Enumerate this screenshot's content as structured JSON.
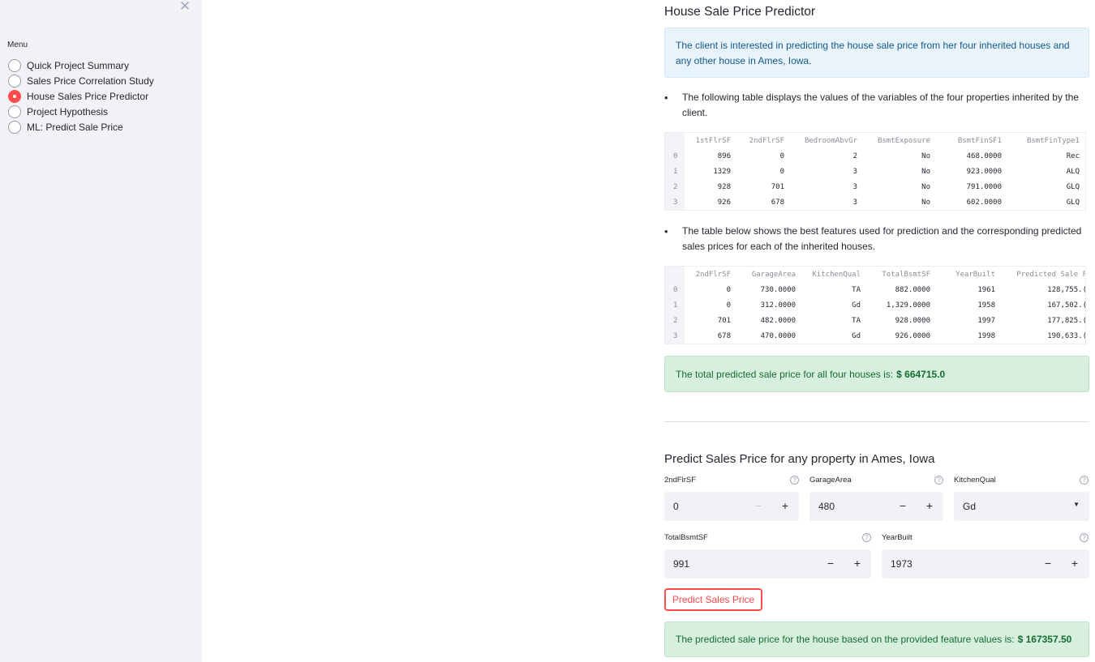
{
  "sidebar": {
    "close_icon": "close-icon",
    "menu_label": "Menu",
    "items": [
      {
        "label": "Quick Project Summary",
        "selected": false
      },
      {
        "label": "Sales Price Correlation Study",
        "selected": false
      },
      {
        "label": "House Sales Price Predictor",
        "selected": true
      },
      {
        "label": "Project Hypothesis",
        "selected": false
      },
      {
        "label": "ML: Predict Sale Price",
        "selected": false
      }
    ]
  },
  "main": {
    "title": "House Sale Price Predictor",
    "info": "The client is interested in predicting the house sale price from her four inherited houses and any other house in Ames, Iowa.",
    "bullet1": "The following table displays the values of the variables of the four properties inherited by the client.",
    "table1": {
      "columns": [
        "1stFlrSF",
        "2ndFlrSF",
        "BedroomAbvGr",
        "BsmtExposure",
        "BsmtFinSF1",
        "BsmtFinType1"
      ],
      "rows": [
        {
          "index": "0",
          "cells": [
            "896",
            "0",
            "2",
            "No",
            "468.0000",
            "Rec"
          ]
        },
        {
          "index": "1",
          "cells": [
            "1329",
            "0",
            "3",
            "No",
            "923.0000",
            "ALQ"
          ]
        },
        {
          "index": "2",
          "cells": [
            "928",
            "701",
            "3",
            "No",
            "791.0000",
            "GLQ"
          ]
        },
        {
          "index": "3",
          "cells": [
            "926",
            "678",
            "3",
            "No",
            "602.0000",
            "GLQ"
          ]
        }
      ]
    },
    "bullet2": "The table below shows the best features used for prediction and the corresponding predicted sales prices for each of the inherited houses.",
    "table2": {
      "columns": [
        "2ndFlrSF",
        "GarageArea",
        "KitchenQual",
        "TotalBsmtSF",
        "YearBuilt",
        "Predicted Sale P"
      ],
      "rows": [
        {
          "index": "0",
          "cells": [
            "0",
            "730.0000",
            "TA",
            "882.0000",
            "1961",
            "128,755.("
          ]
        },
        {
          "index": "1",
          "cells": [
            "0",
            "312.0000",
            "Gd",
            "1,329.0000",
            "1958",
            "167,502.("
          ]
        },
        {
          "index": "2",
          "cells": [
            "701",
            "482.0000",
            "TA",
            "928.0000",
            "1997",
            "177,825.("
          ]
        },
        {
          "index": "3",
          "cells": [
            "678",
            "470.0000",
            "Gd",
            "926.0000",
            "1998",
            "190,633.("
          ]
        }
      ]
    },
    "total_text": "The total predicted sale price for all four houses is:",
    "total_value": "$ 664715.0",
    "subheader": "Predict Sales Price for any property in Ames, Iowa",
    "inputs": {
      "f2ndflrsf": {
        "label": "2ndFlrSF",
        "value": "0"
      },
      "garagearea": {
        "label": "GarageArea",
        "value": "480"
      },
      "kitchenqual": {
        "label": "KitchenQual",
        "value": "Gd"
      },
      "totalbsmtsf": {
        "label": "TotalBsmtSF",
        "value": "991"
      },
      "yearbuilt": {
        "label": "YearBuilt",
        "value": "1973"
      }
    },
    "button_label": "Predict Sales Price",
    "result_text": "The predicted sale price for the house based on the provided feature values is:",
    "result_value": "$ 167357.50"
  }
}
